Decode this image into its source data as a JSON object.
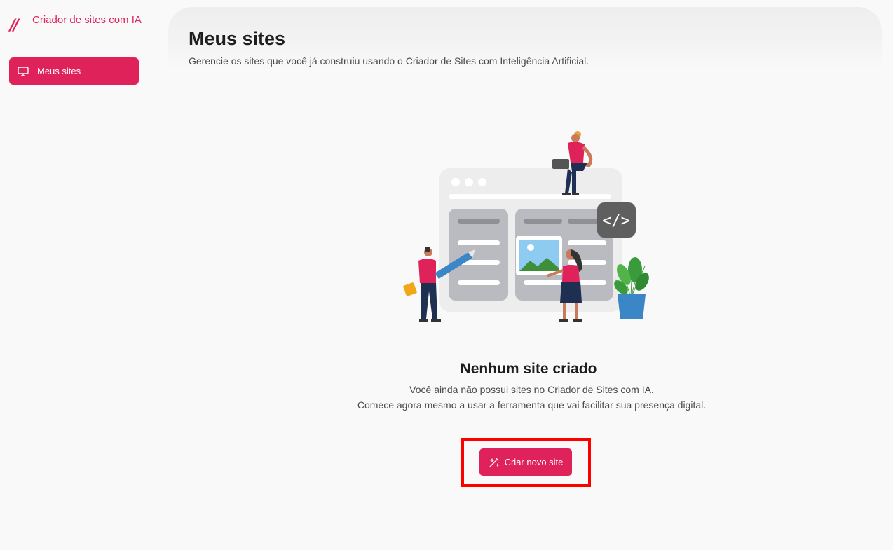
{
  "sidebar": {
    "brand_mark": "//",
    "brand_text": "Criador de sites com IA",
    "items": [
      {
        "label": "Meus sites",
        "icon": "monitor-icon",
        "active": true
      }
    ]
  },
  "main": {
    "title": "Meus sites",
    "subtitle": "Gerencie os sites que você já construiu usando o Criador de Sites com Inteligência Artificial."
  },
  "empty_state": {
    "title": "Nenhum site criado",
    "line1": "Você ainda não possui sites no Criador de Sites com IA.",
    "line2": "Comece agora mesmo a usar a ferramenta que vai facilitar sua presença digital.",
    "button_label": "Criar novo site",
    "button_icon": "magic-wand-icon",
    "illustration": "website-builder-illustration"
  },
  "colors": {
    "accent": "#e0225a",
    "highlight_box": "#ff0000",
    "background": "#f9f9f9"
  }
}
